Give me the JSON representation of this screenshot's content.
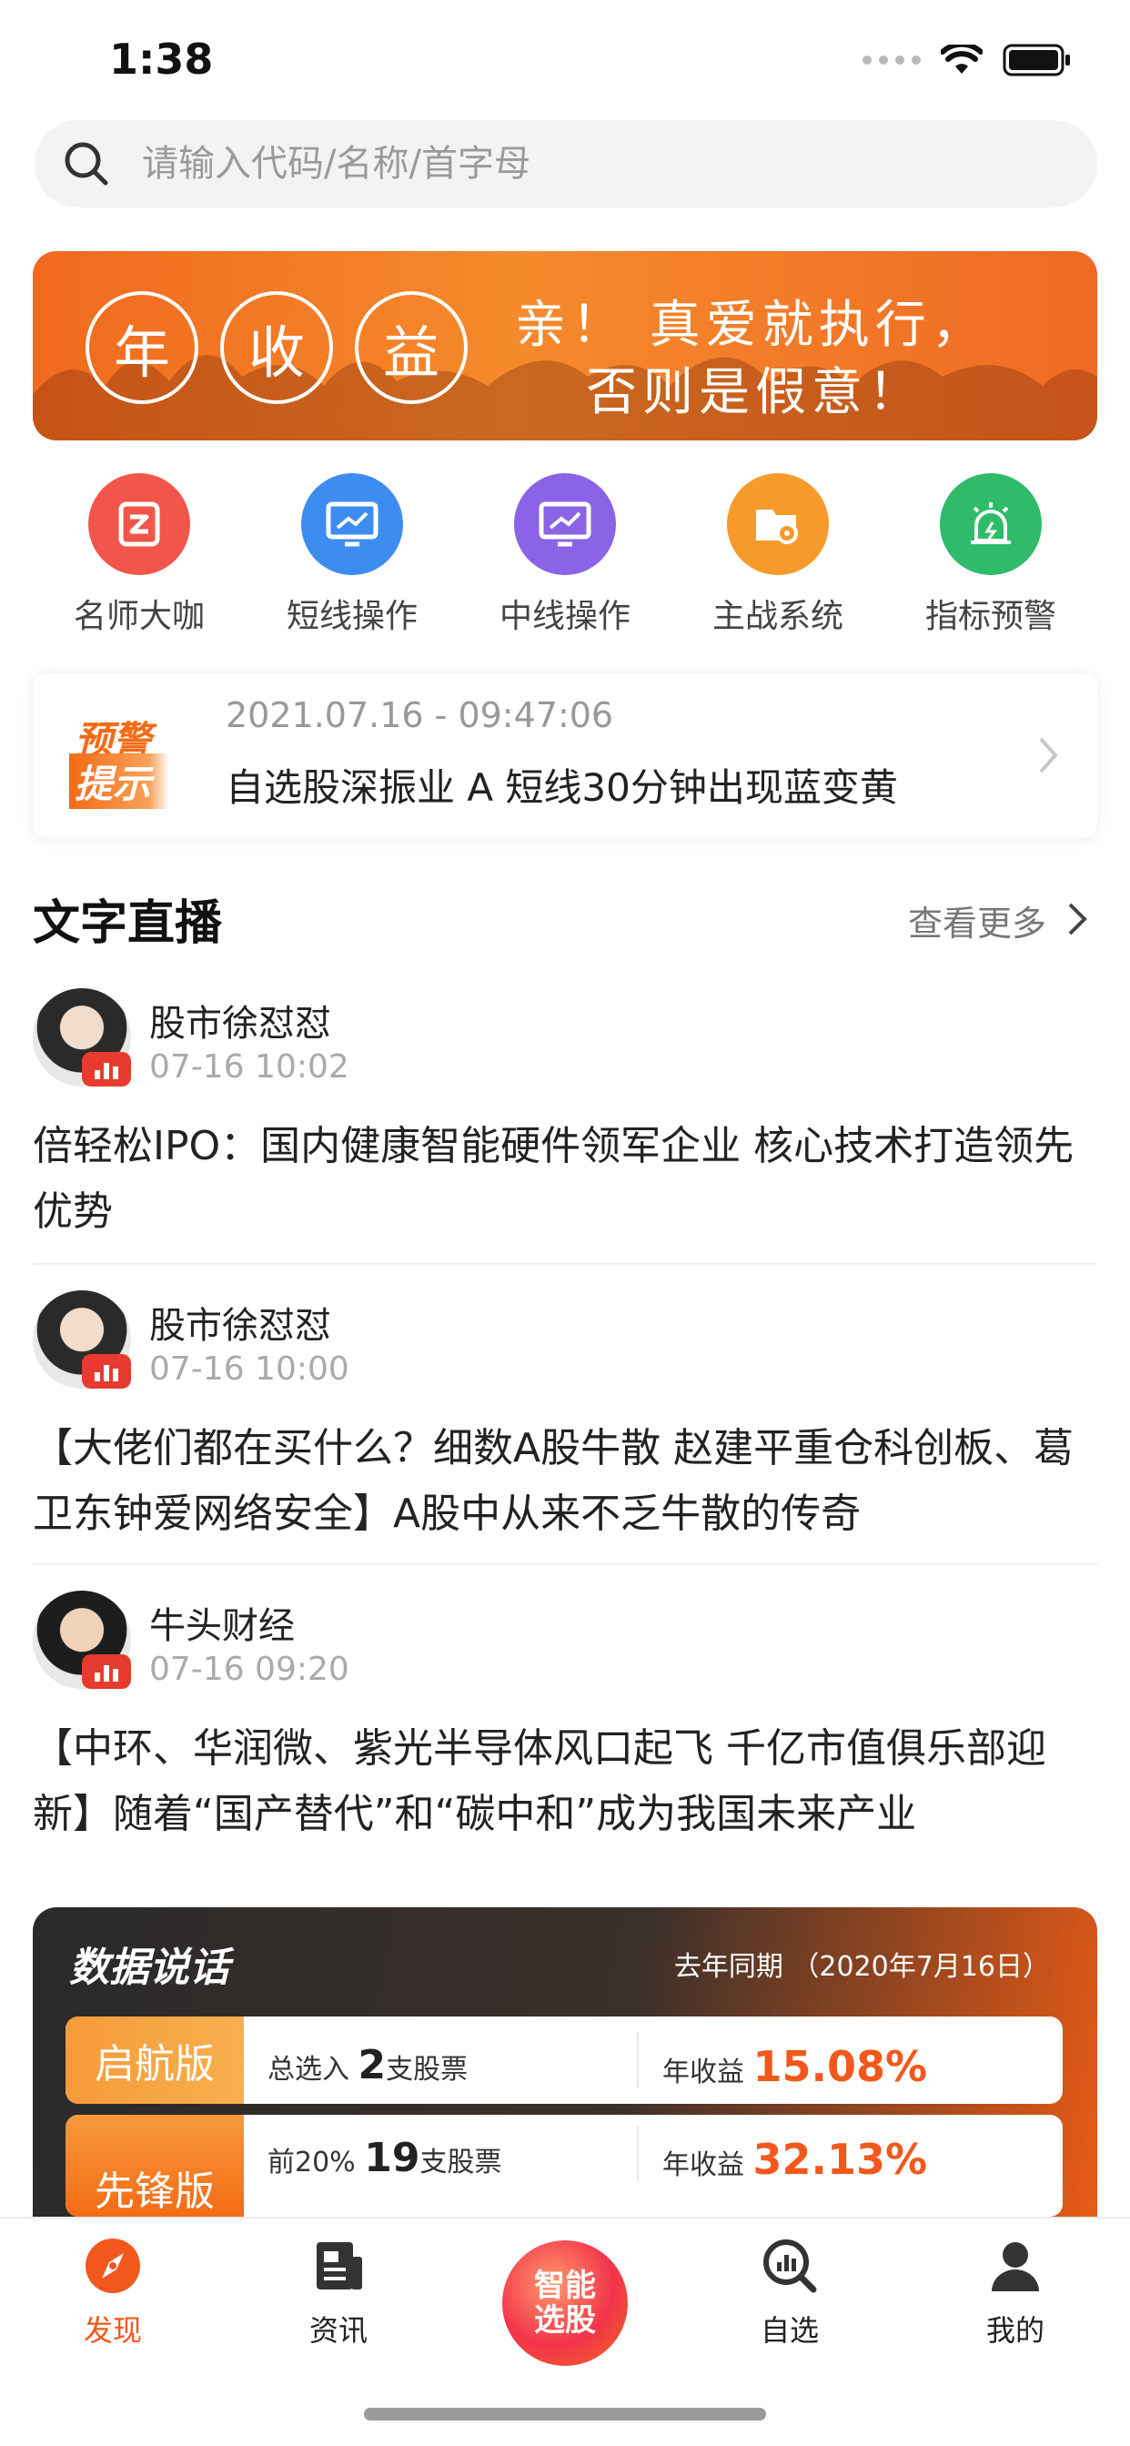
{
  "status_bar": {
    "time": "1:38"
  },
  "search": {
    "placeholder": "请输入代码/名称/首字母"
  },
  "banner": {
    "circles": [
      "年",
      "收",
      "益"
    ],
    "line1": "亲！ 真爱就执行，",
    "line2": "否则是假意！"
  },
  "menu": [
    {
      "label": "名师大咖",
      "icon": "teacher-icon",
      "color": "#f2554a"
    },
    {
      "label": "短线操作",
      "icon": "monitor-chart-icon",
      "color": "#3d8df0"
    },
    {
      "label": "中线操作",
      "icon": "monitor-chart-icon",
      "color": "#8a63e6"
    },
    {
      "label": "主战系统",
      "icon": "settings-folder-icon",
      "color": "#f79a2c"
    },
    {
      "label": "指标预警",
      "icon": "alarm-icon",
      "color": "#2fbb6a"
    }
  ],
  "alert": {
    "badge_top": "预警",
    "badge_bottom": "提示",
    "time": "2021.07.16 - 09:47:06",
    "text": "自选股深振业 A 短线30分钟出现蓝变黄"
  },
  "live": {
    "title": "文字直播",
    "more": "查看更多",
    "posts": [
      {
        "author": "股市徐怼怼",
        "time": "07-16 10:02",
        "text": "倍轻松IPO：国内健康智能硬件领军企业 核心技术打造领先优势"
      },
      {
        "author": "股市徐怼怼",
        "time": "07-16 10:00",
        "text": "【大佬们都在买什么？细数A股牛散 赵建平重仓科创板、葛卫东钟爱网络安全】A股中从来不乏牛散的传奇"
      },
      {
        "author": "牛头财经",
        "time": "07-16 09:20",
        "text": "【中环、华润微、紫光半导体风口起飞 千亿市值俱乐部迎新】随着“国产替代”和“碳中和”成为我国未来产业"
      }
    ]
  },
  "data_card": {
    "title": "数据说话",
    "date": "去年同期 （2020年7月16日）",
    "tiers": [
      {
        "name": "启航版",
        "sel_prefix": "总选入",
        "sel_num": "2",
        "sel_suffix": "支股票",
        "ret_label": "年收益",
        "ret_value": "15.08%"
      },
      {
        "name": "先锋版",
        "sel_prefix": "前20%",
        "sel_num": "19",
        "sel_suffix": "支股票",
        "ret_label": "年收益",
        "ret_value": "32.13%"
      }
    ]
  },
  "tabbar": {
    "tabs": [
      {
        "label": "发现",
        "icon": "compass-icon",
        "active": true
      },
      {
        "label": "资讯",
        "icon": "news-icon",
        "active": false
      },
      {
        "label": "智能\n选股",
        "icon": "smart-pick",
        "active": false
      },
      {
        "label": "自选",
        "icon": "chart-search-icon",
        "active": false
      },
      {
        "label": "我的",
        "icon": "user-icon",
        "active": false
      }
    ],
    "center_line1": "智能",
    "center_line2": "选股",
    "active_color": "#f2581c"
  }
}
